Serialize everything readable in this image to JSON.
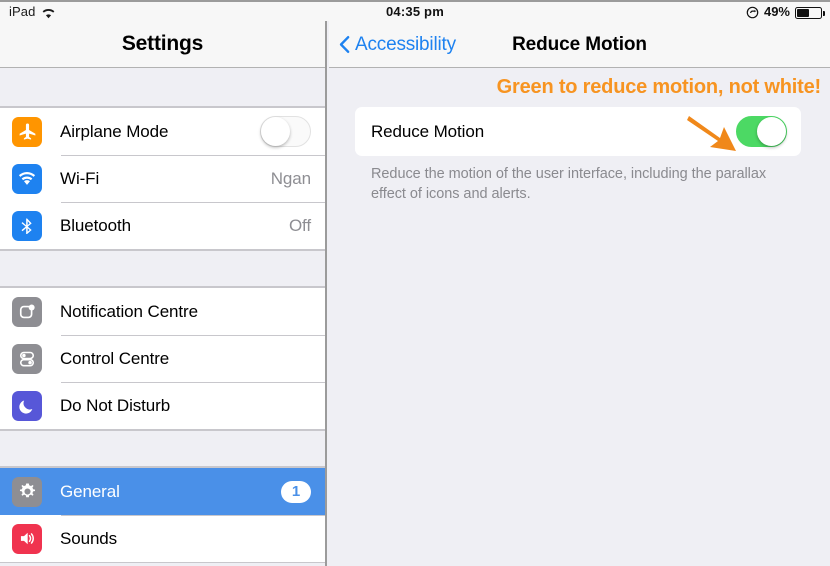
{
  "status_bar": {
    "device_label": "iPad",
    "wifi_icon": "wifi-icon",
    "time": "04:35 pm",
    "rotation_lock_icon": "rotation-lock-icon",
    "battery_percent": "49%",
    "battery_icon": "battery-icon"
  },
  "sidebar": {
    "title": "Settings",
    "groups": [
      {
        "items": [
          {
            "icon": "airplane-icon",
            "label": "Airplane Mode",
            "accessory": "toggle",
            "toggle_on": false,
            "value": ""
          },
          {
            "icon": "wifi-icon",
            "label": "Wi-Fi",
            "accessory": "value",
            "value": "Ngan"
          },
          {
            "icon": "bluetooth-icon",
            "label": "Bluetooth",
            "accessory": "value",
            "value": "Off"
          }
        ]
      },
      {
        "items": [
          {
            "icon": "notification-centre-icon",
            "label": "Notification Centre",
            "accessory": "none",
            "value": ""
          },
          {
            "icon": "control-centre-icon",
            "label": "Control Centre",
            "accessory": "none",
            "value": ""
          },
          {
            "icon": "do-not-disturb-icon",
            "label": "Do Not Disturb",
            "accessory": "none",
            "value": ""
          }
        ]
      },
      {
        "items": [
          {
            "icon": "gear-icon",
            "label": "General",
            "accessory": "badge",
            "value": "1",
            "selected": true
          },
          {
            "icon": "sounds-icon",
            "label": "Sounds",
            "accessory": "none",
            "value": ""
          }
        ]
      }
    ]
  },
  "detail": {
    "back_label": "Accessibility",
    "back_icon": "chevron-left-icon",
    "title": "Reduce Motion",
    "annotation": "Green to reduce motion, not white!",
    "arrow_icon": "arrow-pointer-icon",
    "setting": {
      "label": "Reduce Motion",
      "toggle_on": true
    },
    "footnote": "Reduce the motion of the user interface, including the parallax effect of icons and alerts."
  },
  "colors": {
    "accent_blue": "#1e82f0",
    "selection_blue": "#4a90e8",
    "toggle_green": "#4cd964",
    "annotation_orange": "#f79421",
    "airplane_orange": "#ff9500",
    "dnd_purple": "#5757d8",
    "sounds_red": "#f0334f",
    "grey_icon": "#8e8e93",
    "pane_background": "#efeff4"
  }
}
